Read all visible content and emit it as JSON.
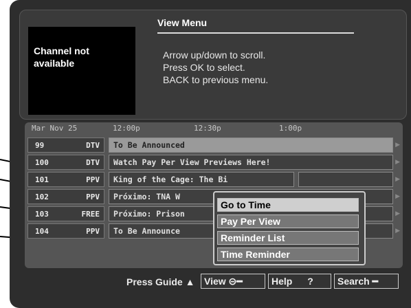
{
  "preview": {
    "text_line1": "Channel not",
    "text_line2": "available"
  },
  "menu": {
    "title": "View Menu",
    "instructions": [
      "Arrow up/down to scroll.",
      "Press OK to select.",
      "BACK to previous menu."
    ]
  },
  "grid": {
    "date": "Mar Nov 25",
    "times": [
      "12:00p",
      "12:30p",
      "1:00p"
    ],
    "rows": [
      {
        "num": "99",
        "name": "DTV",
        "program": "To Be Announced",
        "selected": true
      },
      {
        "num": "100",
        "name": "DTV",
        "program": "Watch Pay Per View Previews Here!",
        "selected": false
      },
      {
        "num": "101",
        "name": "PPV",
        "program": "King of the Cage: The Bi",
        "selected": false
      },
      {
        "num": "102",
        "name": "PPV",
        "program": "Próximo: TNA W",
        "selected": false
      },
      {
        "num": "103",
        "name": "FREE",
        "program": "Próximo: Prison",
        "selected": false
      },
      {
        "num": "104",
        "name": "PPV",
        "program": "To Be Announce",
        "selected": false
      }
    ]
  },
  "popup": {
    "items": [
      "Go to Time",
      "Pay Per View",
      "Reminder List",
      "Time Reminder"
    ],
    "active_index": 0
  },
  "footer": {
    "press_guide": "Press Guide",
    "view_label": "View",
    "help_label": "Help",
    "help_icon": "?",
    "search_label": "Search"
  }
}
